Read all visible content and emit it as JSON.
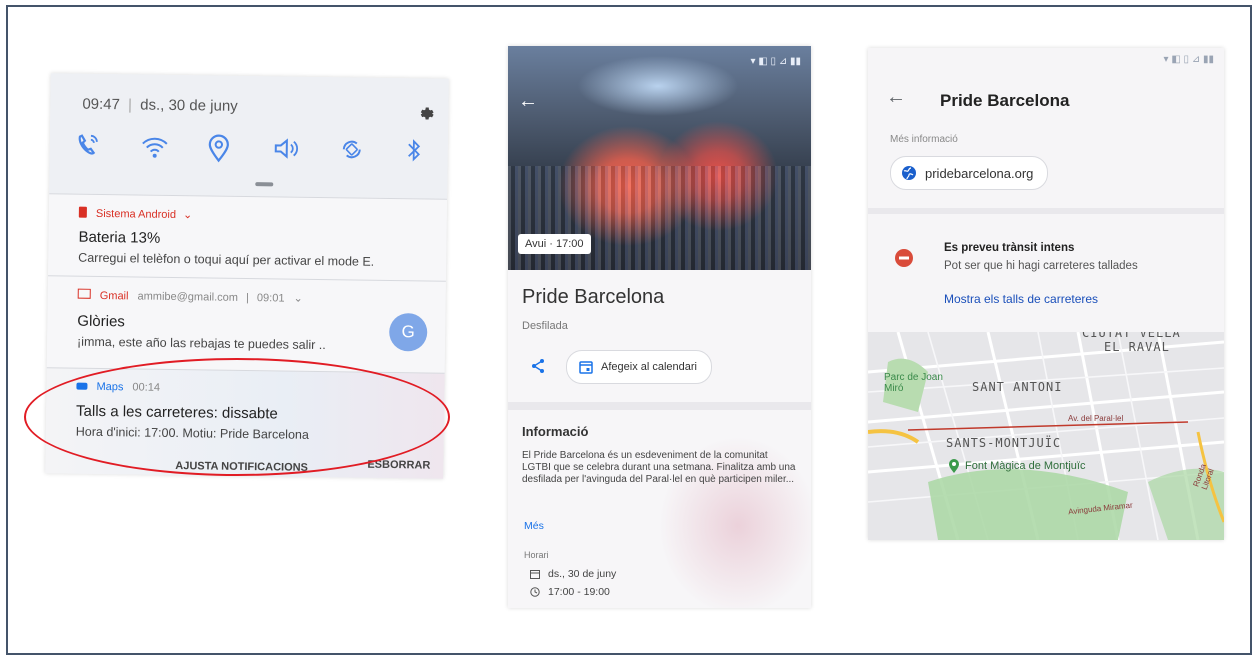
{
  "notifications_panel": {
    "time": "09:47",
    "date": "ds., 30 de juny",
    "quick_settings": [
      "phone-wifi-icon",
      "wifi-icon",
      "location-icon",
      "volume-icon",
      "autorotate-icon",
      "bluetooth-icon"
    ],
    "items": [
      {
        "app": "Sistema Android",
        "app_color": "#d93025",
        "title": "Bateria 13%",
        "body": "Carregui el telèfon o toqui aquí per activar el mode E."
      },
      {
        "app": "Gmail",
        "account": "ammibe@gmail.com",
        "time": "09:01",
        "app_color": "#d93025",
        "title": "Glòries",
        "body": "¡imma, este año las rebajas te puedes salir ..",
        "avatar_letter": "G"
      },
      {
        "app": "Maps",
        "time": "00:14",
        "app_color": "#1a73e8",
        "title": "Talls a les carreteres: dissabte",
        "body": "Hora d'inici: 17:00. Motiu: Pride Barcelona"
      }
    ],
    "footer": {
      "adjust": "AJUSTA NOTIFICACIONS",
      "clear": "ESBORRAR"
    },
    "highlight_color": "#e11c24"
  },
  "event_panel": {
    "photo_chip": "Avui · 17:00",
    "title": "Pride Barcelona",
    "subtitle": "Desfilada",
    "calendar_button": "Afegeix al calendari",
    "info_heading": "Informació",
    "description": "El Pride Barcelona és un esdeveniment de la comunitat LGTBI que se celebra durant una setmana. Finalitza amb una desfilada per l'avinguda del Paral·lel en què participen miler...",
    "more_link": "Més",
    "schedule_label": "Horari",
    "date": "ds., 30 de juny",
    "time_range": "17:00 - 19:00"
  },
  "map_panel": {
    "title": "Pride Barcelona",
    "more_info": "Més informació",
    "website": "pridebarcelona.org",
    "traffic_heading": "Es preveu trànsit intens",
    "traffic_body": "Pot ser que hi hagi carreteres tallades",
    "traffic_link": "Mostra els talls de carreteres",
    "map_labels": {
      "ciutat_vella": "CIUTAT VELLA",
      "el_raval": "EL RAVAL",
      "sant_antoni": "SANT ANTONI",
      "sants_montjuic": "SANTS-MONTJUÏC",
      "park": "Parc de Joan Miró",
      "poi": "Font Màgica de Montjuïc",
      "avinguda": "Av. del Paral·lel",
      "road_r": "Ronda Litoral",
      "road_b": "Avinguda Miramar"
    },
    "accent": "#1a4fba",
    "warning_color": "#d94b3a"
  }
}
